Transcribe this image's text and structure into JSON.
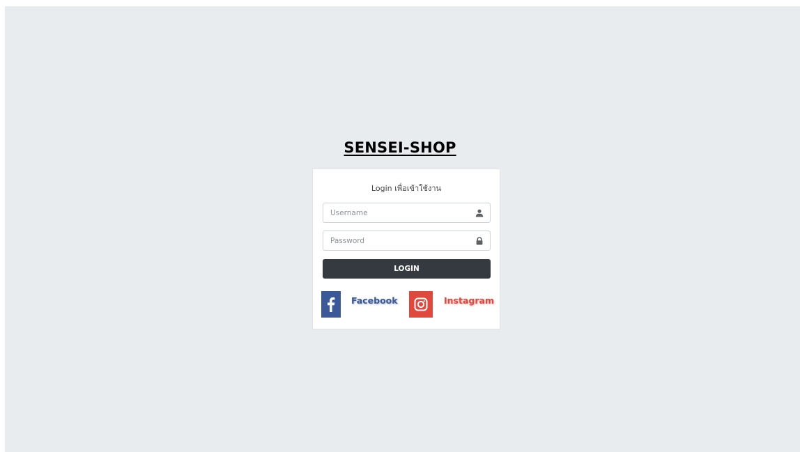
{
  "brand": {
    "title": "SENSEI-SHOP"
  },
  "login_card": {
    "message": "Login เพื่อเข้าใช้งาน",
    "username": {
      "placeholder": "Username",
      "value": "",
      "icon": "user-icon"
    },
    "password": {
      "placeholder": "Password",
      "value": "",
      "icon": "lock-icon"
    },
    "login_button_label": "LOGIN"
  },
  "social": {
    "facebook": {
      "label": "Facebook",
      "icon": "facebook-icon",
      "color": "#3b5998"
    },
    "instagram": {
      "label": "Instagram",
      "icon": "instagram-icon",
      "color": "#e0473d"
    }
  },
  "colors": {
    "page_background": "#e9ecef",
    "card_background": "#ffffff",
    "button_background": "#343a40",
    "button_text": "#ffffff"
  }
}
